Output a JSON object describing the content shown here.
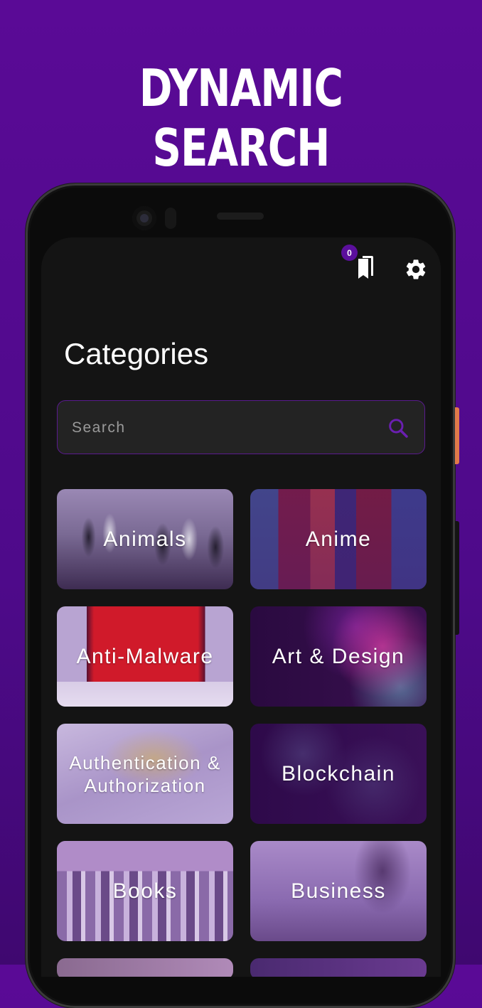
{
  "headline": "DYNAMIC SEARCH",
  "header": {
    "bookmark_count": "0"
  },
  "page_title": "Categories",
  "search": {
    "placeholder": "Search",
    "value": ""
  },
  "categories": [
    {
      "label": "Animals"
    },
    {
      "label": "Anime"
    },
    {
      "label": "Anti-Malware"
    },
    {
      "label": "Art & Design"
    },
    {
      "label": "Authentication & Authorization"
    },
    {
      "label": "Blockchain"
    },
    {
      "label": "Books"
    },
    {
      "label": "Business"
    }
  ],
  "colors": {
    "background": "#5a0a96",
    "accent": "#5b0f9c",
    "screen": "#141414"
  }
}
